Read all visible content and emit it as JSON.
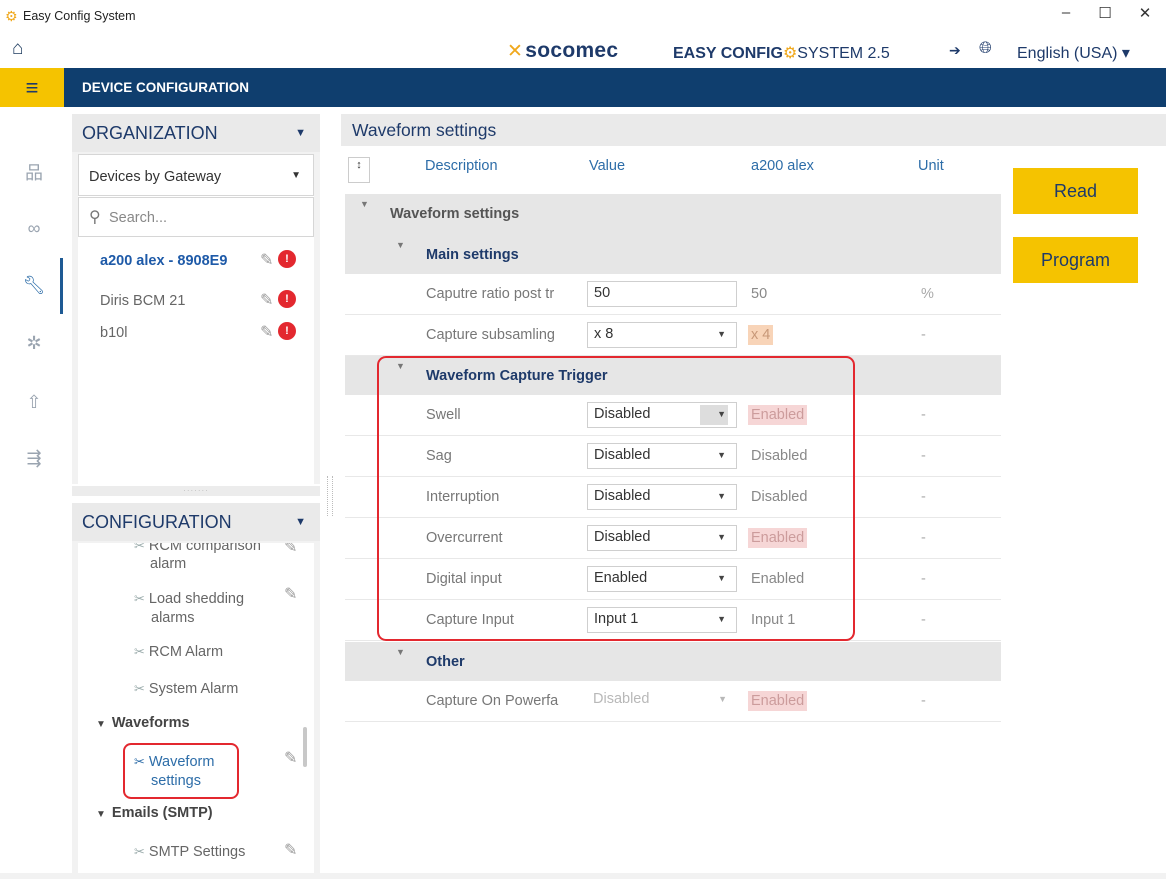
{
  "window": {
    "title": "Easy Config System",
    "minimize": "–",
    "maximize": "☐",
    "close": "✕"
  },
  "header": {
    "brand": "socomec",
    "product": "EASY CONFIG",
    "product_suffix": "SYSTEM 2.5",
    "language": "English (USA) ▾"
  },
  "band": {
    "title": "DEVICE CONFIGURATION"
  },
  "organization": {
    "title": "ORGANIZATION",
    "view_select": "Devices by Gateway",
    "search_placeholder": "Search...",
    "devices": [
      {
        "name": "a200 alex - 8908E9",
        "selected": true
      },
      {
        "name": "Diris BCM 21",
        "selected": false
      },
      {
        "name": "b10l",
        "selected": false
      }
    ]
  },
  "configuration": {
    "title": "CONFIGURATION",
    "items": {
      "rcm_comparison_1": "RCM comparison",
      "rcm_comparison_2": "alarm",
      "load_shedding_1": "Load shedding",
      "load_shedding_2": "alarms",
      "rcm_alarm": "RCM Alarm",
      "system_alarm": "System Alarm",
      "group_waveforms": "Waveforms",
      "waveform_settings_1": "Waveform",
      "waveform_settings_2": "settings",
      "group_emails": "Emails (SMTP)",
      "smtp_settings": "SMTP Settings"
    }
  },
  "main": {
    "title": "Waveform settings",
    "columns": {
      "description": "Description",
      "value": "Value",
      "device": "a200 alex",
      "unit": "Unit"
    },
    "sections": {
      "root": "Waveform settings",
      "main_settings": "Main settings",
      "trigger": "Waveform Capture Trigger",
      "other": "Other"
    },
    "rows": {
      "capture_ratio": {
        "desc": "Caputre ratio post tr",
        "value": "50",
        "device": "50",
        "unit": "%"
      },
      "capture_subsampling": {
        "desc": "Capture subsamling",
        "value": "x 8",
        "device": "x 4",
        "unit": "-"
      },
      "swell": {
        "desc": "Swell",
        "value": "Disabled",
        "device": "Enabled",
        "unit": "-"
      },
      "sag": {
        "desc": "Sag",
        "value": "Disabled",
        "device": "Disabled",
        "unit": "-"
      },
      "interruption": {
        "desc": "Interruption",
        "value": "Disabled",
        "device": "Disabled",
        "unit": "-"
      },
      "overcurrent": {
        "desc": "Overcurrent",
        "value": "Disabled",
        "device": "Enabled",
        "unit": "-"
      },
      "digital_input": {
        "desc": "Digital input",
        "value": "Enabled",
        "device": "Enabled",
        "unit": "-"
      },
      "capture_input": {
        "desc": "Capture Input",
        "value": "Input 1",
        "device": "Input 1",
        "unit": "-"
      },
      "capture_powerfail": {
        "desc": "Capture On Powerfa",
        "value": "Disabled",
        "device": "Enabled",
        "unit": "-"
      }
    }
  },
  "actions": {
    "read": "Read",
    "program": "Program"
  },
  "colors": {
    "band": "#0f3e6e",
    "accent": "#f5c300",
    "highlight": "#e3282f"
  }
}
